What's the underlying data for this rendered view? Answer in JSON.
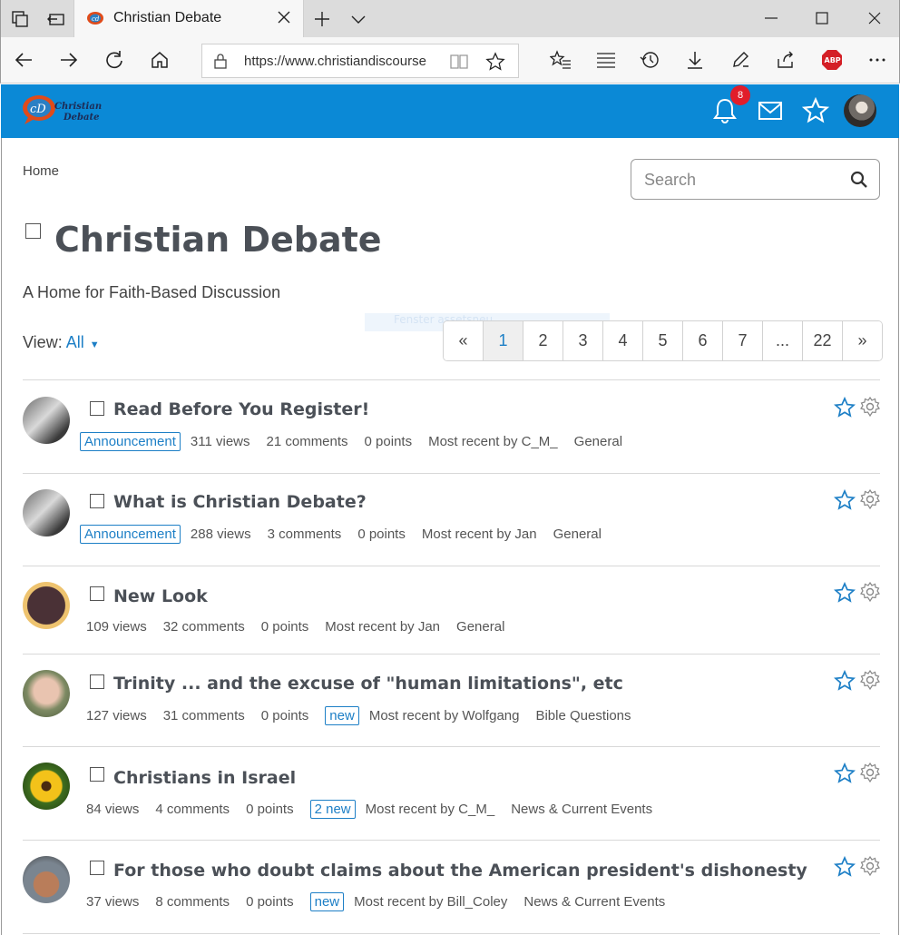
{
  "browser": {
    "tab_title": "Christian Debate",
    "url": "https://www.christiandiscourse"
  },
  "site": {
    "logo_line1": "Christian",
    "logo_line2": "Debate",
    "notification_count": "8"
  },
  "page": {
    "breadcrumb": "Home",
    "search_placeholder": "Search",
    "title": "Christian Debate",
    "subtitle": "A Home for Faith-Based Discussion",
    "view_label": "View:",
    "view_value": "All",
    "faded_text": "Fenster assetsneu"
  },
  "pager": [
    "«",
    "1",
    "2",
    "3",
    "4",
    "5",
    "6",
    "7",
    "...",
    "22",
    "»"
  ],
  "topics": [
    {
      "title": "Read Before You Register!",
      "tag": "Announcement",
      "views": "311 views",
      "comments": "21 comments",
      "points": "0 points",
      "new": "",
      "recent": "Most recent by C_M_",
      "category": "General"
    },
    {
      "title": "What is Christian Debate?",
      "tag": "Announcement",
      "views": "288 views",
      "comments": "3 comments",
      "points": "0 points",
      "new": "",
      "recent": "Most recent by Jan",
      "category": "General"
    },
    {
      "title": "New Look",
      "tag": "",
      "views": "109 views",
      "comments": "32 comments",
      "points": "0 points",
      "new": "",
      "recent": "Most recent by Jan",
      "category": "General"
    },
    {
      "title": "Trinity ... and the excuse of \"human limitations\", etc",
      "tag": "",
      "views": "127 views",
      "comments": "31 comments",
      "points": "0 points",
      "new": "new",
      "recent": "Most recent by Wolfgang",
      "category": "Bible Questions"
    },
    {
      "title": "Christians in Israel",
      "tag": "",
      "views": "84 views",
      "comments": "4 comments",
      "points": "0 points",
      "new": "2 new",
      "recent": "Most recent by C_M_",
      "category": "News & Current Events"
    },
    {
      "title": "For those who doubt claims about the American president's dishonesty",
      "tag": "",
      "views": "37 views",
      "comments": "8 comments",
      "points": "0 points",
      "new": "new",
      "recent": "Most recent by Bill_Coley",
      "category": "News & Current Events"
    }
  ],
  "colors": {
    "header_blue": "#0b89d6",
    "link_blue": "#1d7fc6",
    "badge_red": "#e11d2a"
  }
}
